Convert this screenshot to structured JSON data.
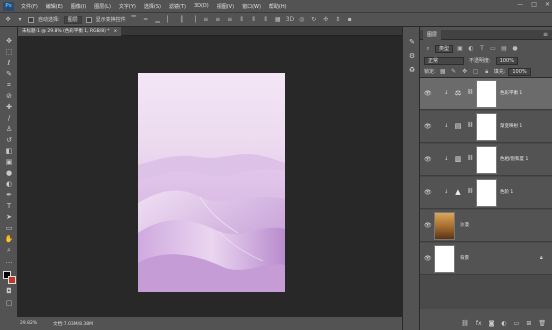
{
  "app": {
    "logo": "Ps"
  },
  "menu": [
    "文件(F)",
    "编辑(E)",
    "图像(I)",
    "图层(L)",
    "文字(Y)",
    "选择(S)",
    "滤镜(T)",
    "3D(D)",
    "视图(V)",
    "窗口(W)",
    "帮助(H)"
  ],
  "window_controls": {
    "minimize": "—",
    "maximize": "□",
    "close": "✕"
  },
  "options": {
    "auto_select_label": "自动选择:",
    "auto_select_value": "图层",
    "transform_label": "显示变换控件"
  },
  "document": {
    "tab_title": "未标题-1 @ 29.8% (色彩平衡 1, RGB/8) *",
    "close": "×"
  },
  "status": {
    "zoom": "29.82%",
    "doc_info": "文档:7.03M/8.38M"
  },
  "panel": {
    "tab": "图层",
    "filter_label": "类型",
    "blend_mode": "正常",
    "opacity_label": "不透明度:",
    "opacity_value": "100%",
    "lock_label": "锁定:",
    "fill_label": "填充:",
    "fill_value": "100%"
  },
  "layers": [
    {
      "name": "色彩平衡 1",
      "icon": "balance-icon",
      "glyph": "⚖",
      "selected": true
    },
    {
      "name": "渐变映射 1",
      "icon": "gradient-map-icon",
      "glyph": "▤",
      "selected": false
    },
    {
      "name": "色相/饱和度 1",
      "icon": "hue-sat-icon",
      "glyph": "▥",
      "selected": false
    },
    {
      "name": "色阶 1",
      "icon": "levels-icon",
      "glyph": "▲",
      "selected": false
    },
    {
      "name": "沙漠",
      "selected": false
    },
    {
      "name": "背景",
      "selected": false
    }
  ],
  "colors": {
    "accent": "#4fb0ff",
    "panel": "#535353",
    "canvas": "#282828",
    "selected": "#6b6b6b",
    "fg_swatch": "#000000",
    "bg_swatch": "#c0392b"
  }
}
